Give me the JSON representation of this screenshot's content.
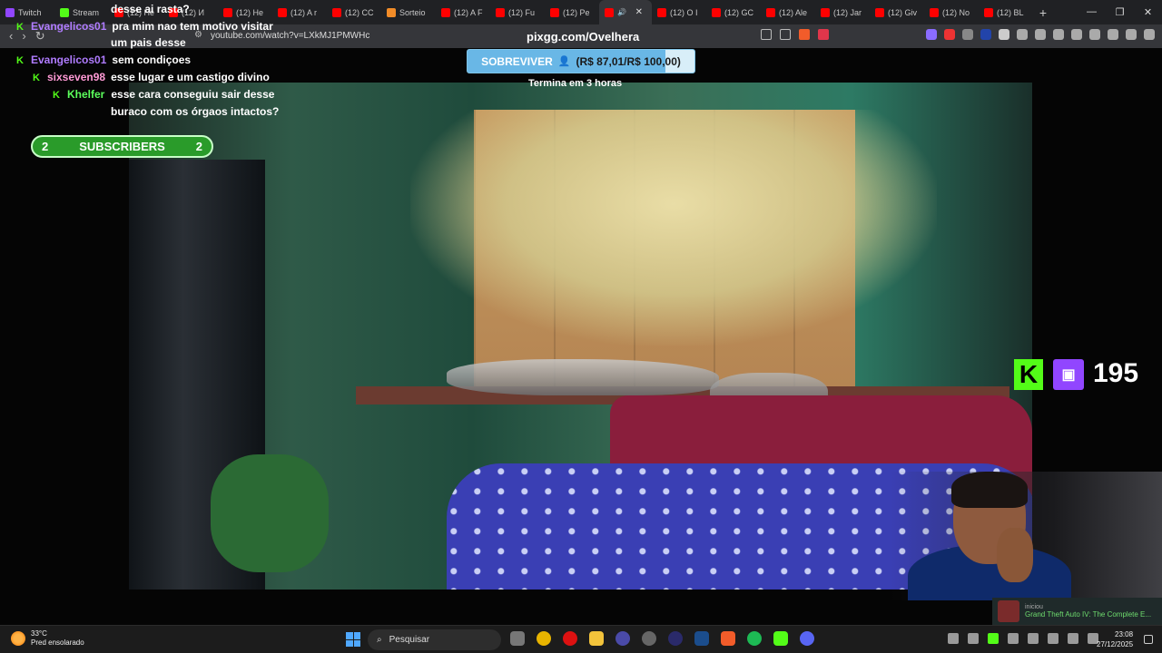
{
  "browser": {
    "tabs": [
      {
        "label": "Twitch",
        "fav": "#9146ff"
      },
      {
        "label": "Stream",
        "fav": "#53fc18"
      },
      {
        "label": "(12) He",
        "fav": "#ff0000"
      },
      {
        "label": "(12) И",
        "fav": "#ff0000"
      },
      {
        "label": "(12) He",
        "fav": "#ff0000"
      },
      {
        "label": "(12) A r",
        "fav": "#ff0000"
      },
      {
        "label": "(12) CC",
        "fav": "#ff0000"
      },
      {
        "label": "Sorteio",
        "fav": "#f28c28"
      },
      {
        "label": "(12) A F",
        "fav": "#ff0000"
      },
      {
        "label": "(12) Fu",
        "fav": "#ff0000"
      },
      {
        "label": "(12) Pe",
        "fav": "#ff0000"
      },
      {
        "label": "",
        "fav": "#ff0000",
        "active": true
      },
      {
        "label": "(12) O I",
        "fav": "#ff0000"
      },
      {
        "label": "(12) GC",
        "fav": "#ff0000"
      },
      {
        "label": "(12) Ale",
        "fav": "#ff0000"
      },
      {
        "label": "(12) Jar",
        "fav": "#ff0000"
      },
      {
        "label": "(12) Giv",
        "fav": "#ff0000"
      },
      {
        "label": "(12) No",
        "fav": "#ff0000"
      },
      {
        "label": "(12) BL",
        "fav": "#ff0000"
      }
    ],
    "url": "youtube.com/watch?v=LXkMJ1PMWHc"
  },
  "overlay": {
    "pix_title": "pixgg.com/Ovelhera",
    "goal_label": "SOBREVIVER",
    "goal_amount": "(R$ 87,01/R$ 100,00)",
    "goal_progress": 0.8701,
    "goal_ends": "Termina em 3 horas",
    "subscribers_label": "SUBSCRIBERS",
    "subscribers_left": "2",
    "subscribers_right": "2",
    "follower_count": "195"
  },
  "chat": [
    {
      "user": "",
      "msg": "desse ai rasta?",
      "color": "#ffffff"
    },
    {
      "user": "Evangelicos01",
      "msg": "pra mim nao tem motivo visitar",
      "color": "#b07cff"
    },
    {
      "user": "",
      "msg": "um pais desse",
      "color": "#ffffff"
    },
    {
      "user": "Evangelicos01",
      "msg": "sem condiçoes",
      "color": "#b07cff"
    },
    {
      "user": "sixseven98",
      "msg": "esse lugar e um castigo divino",
      "color": "#ff9ad5"
    },
    {
      "user": "Khelfer",
      "msg": "esse cara conseguiu sair desse",
      "color": "#5cff5c"
    },
    {
      "user": "",
      "msg": "buraco com os órgaos intactos?",
      "color": "#ffffff"
    }
  ],
  "notification": {
    "small": "iniciou",
    "title": "Grand Theft Auto IV: The Complete E..."
  },
  "taskbar": {
    "temp": "33°C",
    "weather": "Pred ensolarado",
    "search": "Pesquisar",
    "time": "23:08",
    "date": "27/12/2025"
  }
}
